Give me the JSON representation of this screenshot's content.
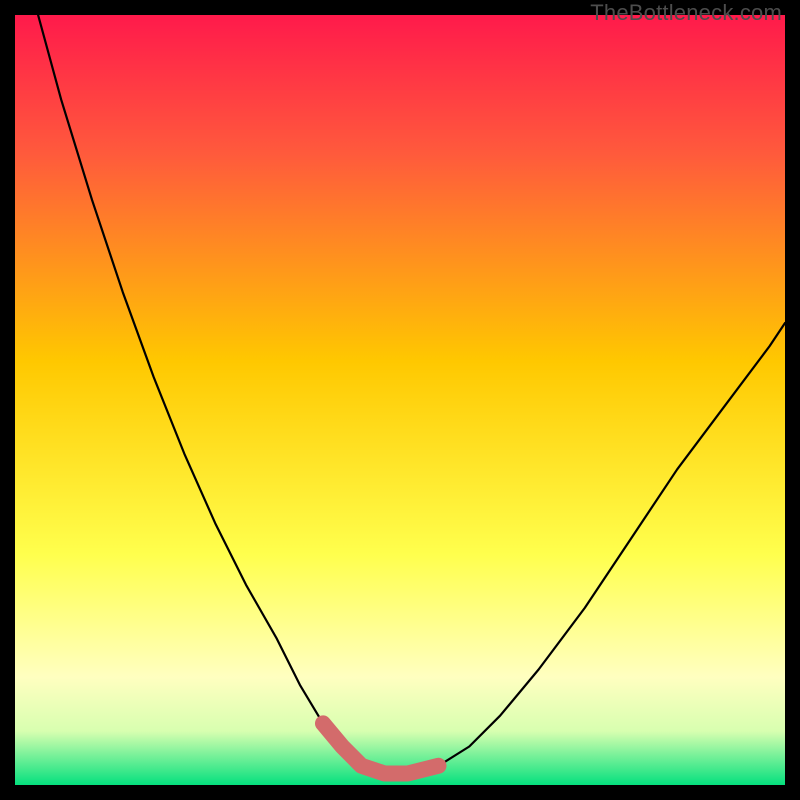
{
  "watermark": "TheBottleneck.com",
  "colors": {
    "gradient": [
      "#ff1a4b",
      "#ff5a3c",
      "#ffc800",
      "#ffff4d",
      "#ffffc0",
      "#d8ffb0",
      "#05e07e"
    ],
    "curve": "#000000",
    "marker": "#d36b6b",
    "frame": "#000000"
  },
  "chart_data": {
    "type": "line",
    "title": "",
    "xlabel": "",
    "ylabel": "",
    "xlim": [
      0,
      100
    ],
    "ylim": [
      0,
      100
    ],
    "grid": false,
    "series": [
      {
        "name": "bottleneck-curve",
        "x": [
          3,
          6,
          10,
          14,
          18,
          22,
          26,
          30,
          34,
          37,
          40,
          42.5,
          45,
          48,
          51,
          55,
          59,
          63,
          68,
          74,
          80,
          86,
          92,
          98,
          100
        ],
        "y": [
          100,
          89,
          76,
          64,
          53,
          43,
          34,
          26,
          19,
          13,
          8,
          5,
          2.5,
          1.5,
          1.5,
          2.5,
          5,
          9,
          15,
          23,
          32,
          41,
          49,
          57,
          60
        ]
      }
    ],
    "annotations": [
      {
        "name": "optimal-range-marker",
        "x": [
          40,
          42.5,
          45,
          48,
          51,
          55
        ],
        "y": [
          8,
          5,
          2.5,
          1.5,
          1.5,
          2.5
        ]
      }
    ]
  }
}
